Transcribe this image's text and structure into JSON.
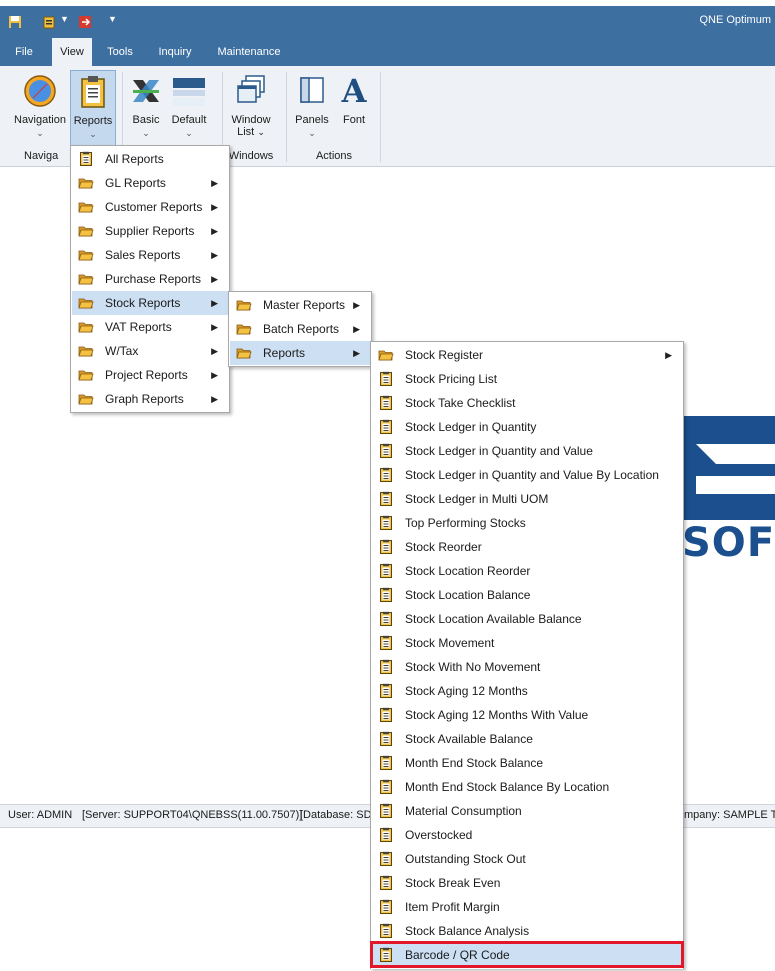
{
  "window": {
    "title": "QNE Optimum"
  },
  "menu_tabs": [
    "File",
    "View",
    "Tools",
    "Inquiry",
    "Maintenance"
  ],
  "ribbon": {
    "navigation": "Navigation",
    "reports": "Reports",
    "basic": "Basic",
    "default": "Default",
    "window_list_1": "Window",
    "window_list_2": "List",
    "panels": "Panels",
    "font": "Font",
    "font_glyph": "A",
    "groups": {
      "navigation": "Naviga",
      "windows": "Windows",
      "actions": "Actions"
    }
  },
  "reports_menu": [
    "All Reports",
    "GL Reports",
    "Customer Reports",
    "Supplier Reports",
    "Sales Reports",
    "Purchase Reports",
    "Stock Reports",
    "VAT Reports",
    "W/Tax",
    "Project Reports",
    "Graph Reports"
  ],
  "stock_reports_menu": [
    "Master Reports",
    "Batch Reports",
    "Reports"
  ],
  "stock_reports_sub": [
    "Stock Register",
    "Stock Pricing List",
    "Stock Take Checklist",
    "Stock Ledger in Quantity",
    "Stock Ledger in Quantity and Value",
    "Stock Ledger in Quantity and Value By Location",
    "Stock Ledger in Multi UOM",
    "Top Performing Stocks",
    "Stock Reorder",
    "Stock Location Reorder",
    "Stock Location Balance",
    "Stock Location Available Balance",
    "Stock Movement",
    "Stock With No Movement",
    "Stock Aging 12 Months",
    "Stock Aging 12 Months With Value",
    "Stock Available Balance",
    "Month End Stock Balance",
    "Month End Stock Balance By Location",
    "Material Consumption",
    "Overstocked",
    "Outstanding Stock Out",
    "Stock Break Even",
    "Item Profit Margin",
    "Stock Balance Analysis",
    "Barcode / QR Code"
  ],
  "status": {
    "user": "User: ADMIN",
    "server": "[Server: SUPPORT04\\QNEBSS(11.00.7507)]",
    "database": "[Database: SD",
    "company": "mpany: SAMPLE TRA"
  },
  "logo": {
    "text": "SOF"
  },
  "colors": {
    "title_bar": "#3d6fa1",
    "ribbon": "#eef1f5",
    "highlight": "#ccdff3",
    "callout": "#e3172a"
  }
}
